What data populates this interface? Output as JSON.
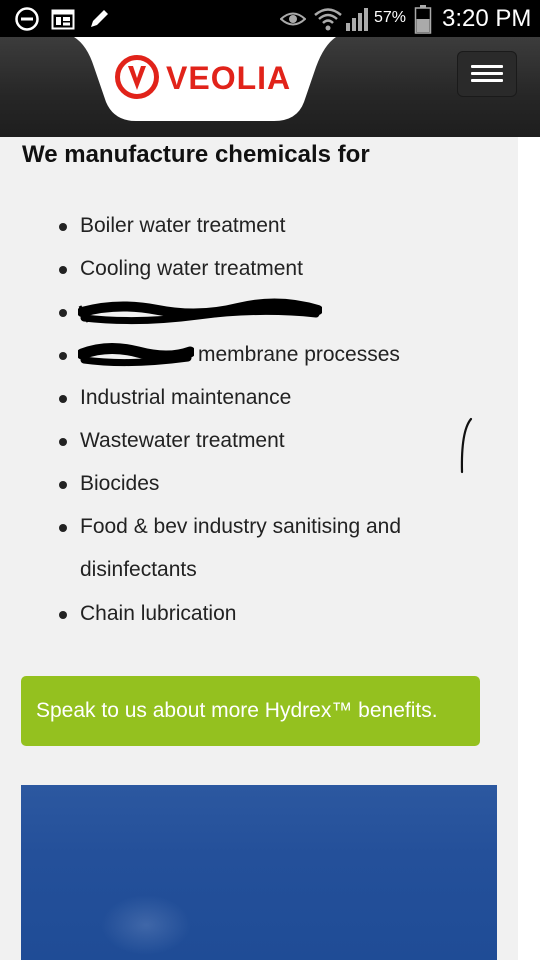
{
  "status_bar": {
    "battery_percent": "57%",
    "time": "3:20 PM",
    "icons": [
      "do-not-disturb-icon",
      "calendar-icon",
      "edit-icon",
      "eye-icon",
      "wifi-icon",
      "signal-icon",
      "battery-icon"
    ]
  },
  "header": {
    "brand": "VEOLIA",
    "brand_color": "#e1231a",
    "menu_icon": "hamburger-menu-icon"
  },
  "content": {
    "heading": "We manufacture chemicals for",
    "items": [
      "Boiler water treatment",
      "Cooling water treatment",
      "",
      "membrane processes",
      "Industrial maintenance",
      "Wastewater treatment",
      "Biocides",
      "Food & bev industry sanitising and",
      "disinfectants",
      "Chain lubrication"
    ],
    "cta_label": "Speak to us about more Hydrex™ benefits.",
    "cta_color": "#94c11f"
  }
}
